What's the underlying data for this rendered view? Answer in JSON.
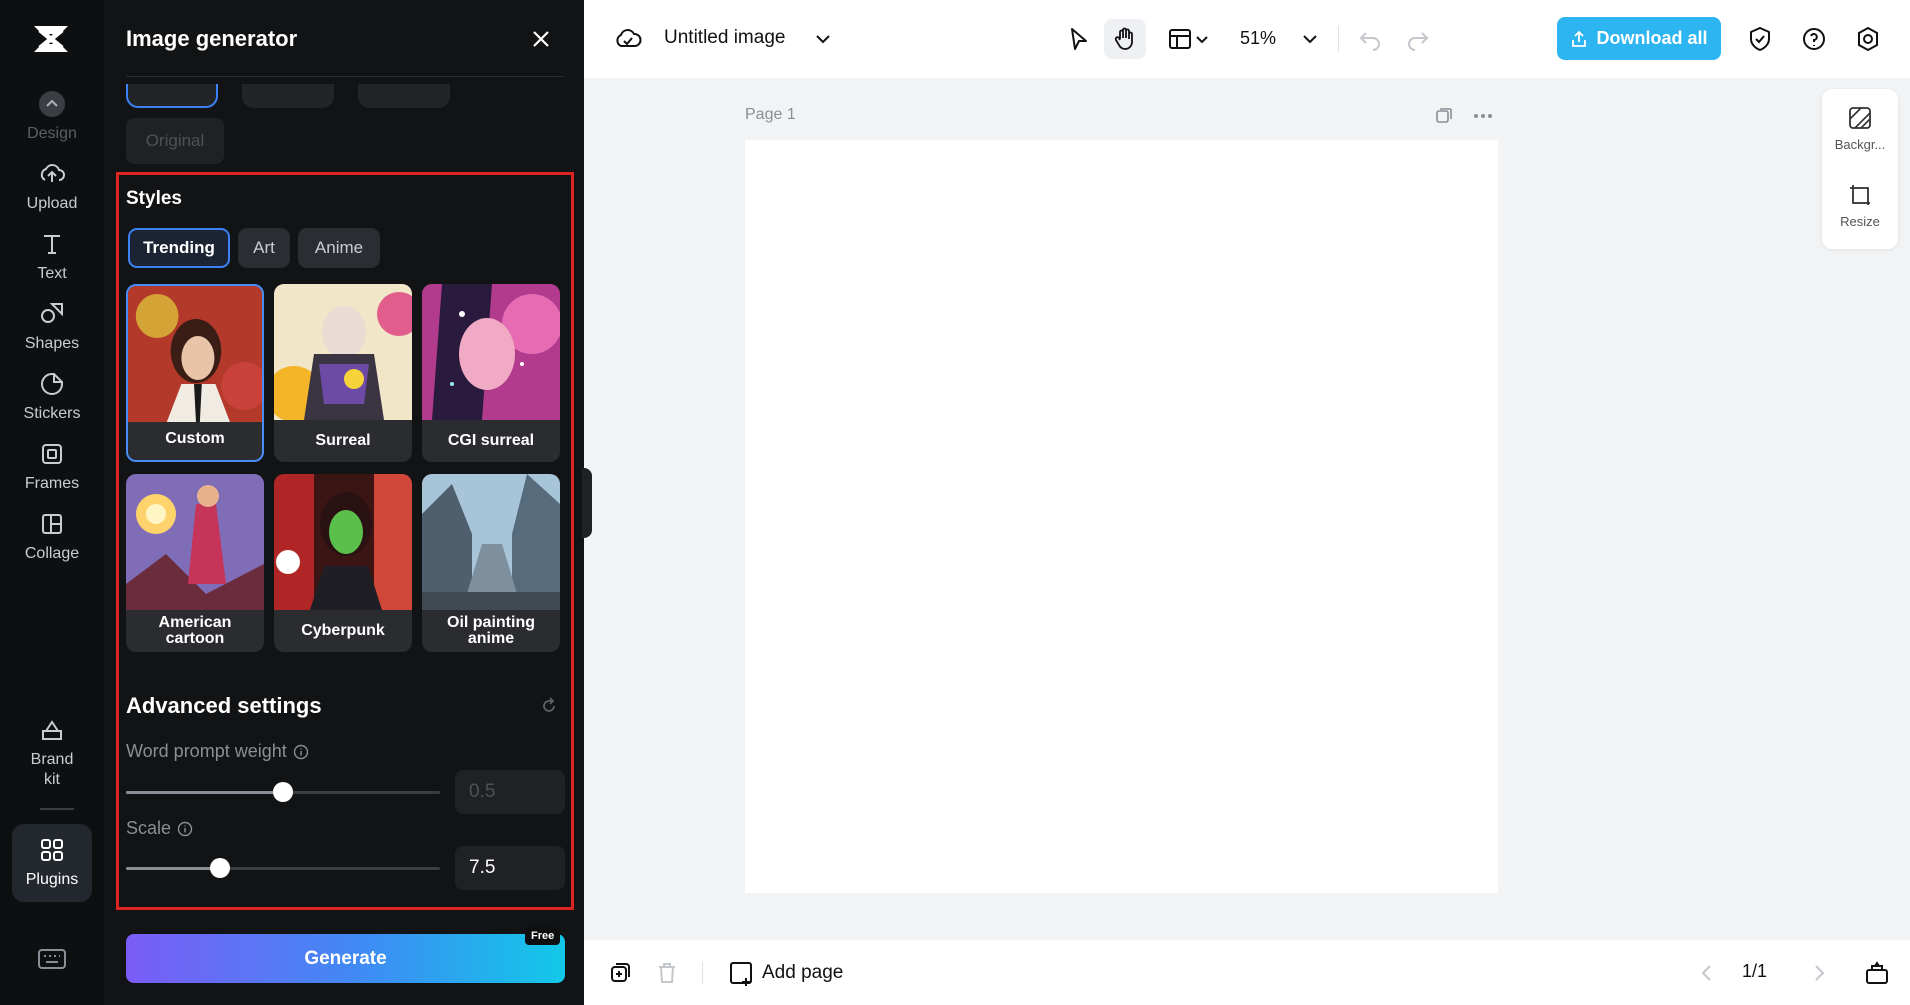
{
  "rail": {
    "items": [
      {
        "label": "Design",
        "icon": "design-icon"
      },
      {
        "label": "Upload",
        "icon": "upload-icon"
      },
      {
        "label": "Text",
        "icon": "text-icon"
      },
      {
        "label": "Shapes",
        "icon": "shapes-icon"
      },
      {
        "label": "Stickers",
        "icon": "stickers-icon"
      },
      {
        "label": "Frames",
        "icon": "frames-icon"
      },
      {
        "label": "Collage",
        "icon": "collage-icon"
      },
      {
        "label": "Brand\nkit",
        "icon": "brand-kit-icon"
      },
      {
        "label": "Plugins",
        "icon": "plugins-icon"
      }
    ]
  },
  "panel": {
    "title": "Image generator",
    "ratio_chip": "Original",
    "styles_title": "Styles",
    "tabs": [
      "Trending",
      "Art",
      "Anime"
    ],
    "active_tab": "Trending",
    "cards": [
      {
        "label": "Custom",
        "selected": true
      },
      {
        "label": "Surreal"
      },
      {
        "label": "CGI surreal"
      },
      {
        "label": "American cartoon"
      },
      {
        "label": "Cyberpunk"
      },
      {
        "label": "Oil painting anime"
      }
    ],
    "advanced_title": "Advanced settings",
    "prompt_weight_label": "Word prompt weight",
    "prompt_weight_value": "0.5",
    "prompt_weight_fraction": 0.5,
    "scale_label": "Scale",
    "scale_value": "7.5",
    "scale_fraction": 0.3,
    "generate_label": "Generate",
    "free_badge": "Free"
  },
  "topbar": {
    "doc_title": "Untitled image",
    "zoom": "51%",
    "download_label": "Download all"
  },
  "canvas": {
    "page_label": "Page 1"
  },
  "side_tools": {
    "background_label": "Backgr...",
    "resize_label": "Resize"
  },
  "bottombar": {
    "add_page_label": "Add page",
    "pager": "1/1"
  },
  "colors": {
    "accent": "#3b82f6",
    "download_bg": "#2cb5f0",
    "highlight_border": "#e02424"
  }
}
